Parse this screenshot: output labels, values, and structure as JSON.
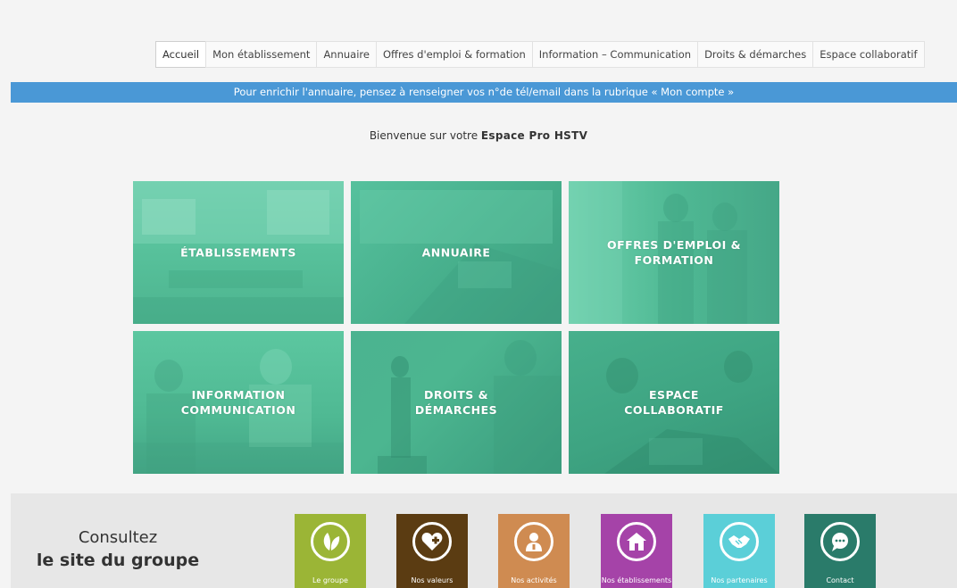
{
  "nav": {
    "items": [
      {
        "label": "Accueil",
        "active": true
      },
      {
        "label": "Mon établissement",
        "active": false
      },
      {
        "label": "Annuaire",
        "active": false
      },
      {
        "label": "Offres d'emploi & formation",
        "active": false
      },
      {
        "label": "Information – Communication",
        "active": false
      },
      {
        "label": "Droits & démarches",
        "active": false
      },
      {
        "label": "Espace collaboratif",
        "active": false
      }
    ]
  },
  "banner": {
    "text": "Pour enrichir l'annuaire, pensez à renseigner vos n°de tél/email dans la rubrique « Mon compte »",
    "color": "#4a98d6"
  },
  "welcome": {
    "prefix": "Bienvenue sur votre",
    "emphasis": "Espace Pro HSTV"
  },
  "tiles": [
    {
      "label": "ÉTABLISSEMENTS"
    },
    {
      "label": "ANNUAIRE"
    },
    {
      "label": "OFFRES D'EMPLOI &\nFORMATION"
    },
    {
      "label": "INFORMATION\nCOMMUNICATION"
    },
    {
      "label": "DROITS &\nDÉMARCHES"
    },
    {
      "label": "ESPACE\nCOLLABORATIF"
    }
  ],
  "footer": {
    "consult_line1": "Consultez",
    "consult_line2": "le site du groupe",
    "buttons": [
      {
        "label": "Le groupe",
        "icon": "leaves-icon",
        "color": "#9bb536"
      },
      {
        "label": "Nos valeurs",
        "icon": "heart-plus-icon",
        "color": "#5b3c12"
      },
      {
        "label": "Nos activités",
        "icon": "doctor-icon",
        "color": "#cf8b51"
      },
      {
        "label": "Nos établissements",
        "icon": "house-icon",
        "color": "#a543a8"
      },
      {
        "label": "Nos partenaires",
        "icon": "handshake-icon",
        "color": "#5bcfd8"
      },
      {
        "label": "Contact",
        "icon": "chat-bubble-icon",
        "color": "#2a7b6a"
      }
    ]
  }
}
